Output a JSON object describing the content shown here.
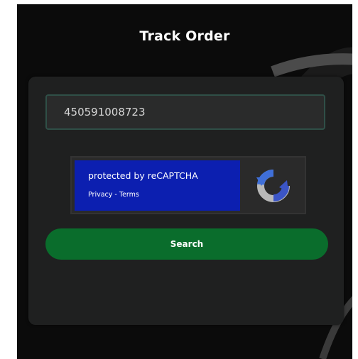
{
  "page": {
    "title": "Track Order"
  },
  "form": {
    "order_number_value": "450591008723",
    "search_label": "Search"
  },
  "recaptcha": {
    "title_prefix": "protected by ",
    "title_brand": "reCAPTCHA",
    "privacy_label": "Privacy",
    "separator": " - ",
    "terms_label": "Terms",
    "logo_icon": "recaptcha-logo-icon"
  },
  "colors": {
    "screen_background": "#0b0b0b",
    "card_background": "#1f2020",
    "recaptcha_blue": "#0c1fb0",
    "search_button_green": "#0a6d2c",
    "input_border": "#2f4f47"
  }
}
